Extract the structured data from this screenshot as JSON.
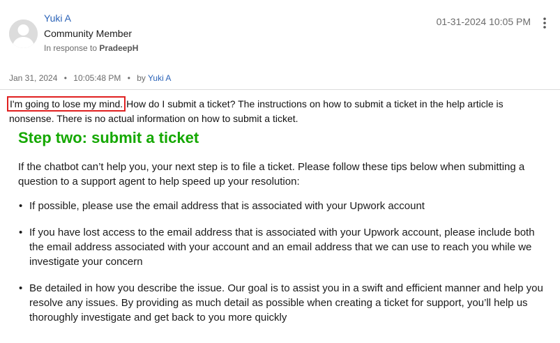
{
  "post": {
    "author_name": "Yuki A",
    "author_rank": "Community Member",
    "in_response_prefix": "In response to",
    "in_response_user": "PradeepH",
    "datetime": "01-31-2024 10:05 PM",
    "menu_icon": "kebab-vertical-icon",
    "avatar_icon": "default-user-avatar-icon"
  },
  "meta": {
    "date": "Jan 31, 2024",
    "separator": "•",
    "time": "10:05:48 PM",
    "by_label": "by",
    "author": "Yuki A"
  },
  "message": {
    "highlighted": "I'm going to lose my mind.",
    "rest": " How do I submit a ticket? The instructions on how to submit a ticket in the help article is nonsense. There is no actual information on how to submit a ticket."
  },
  "article": {
    "heading": "Step two: submit a ticket",
    "intro": "If the chatbot can’t help you, your next step is to file a ticket. Please follow these tips below when submitting a question to a support agent to help speed up your resolution:",
    "bullet_symbol": "•",
    "tips": [
      "If possible, please use the email address that is associated with your Upwork account",
      "If you have lost access to the email address that is associated with your Upwork account, please include both the email address associated with your account and an email address that we can use to reach you while we investigate your concern",
      "Be detailed in how you describe the issue. Our goal is to assist you in a swift and efficient manner and help you resolve any issues. By providing as much detail as possible when creating a ticket for support, you’ll help us thoroughly investigate and get back to you more quickly"
    ]
  },
  "colors": {
    "link_blue": "#2b63b8",
    "heading_green": "#14a800",
    "highlight_red": "#e02020",
    "muted_gray": "#6b6b6b"
  }
}
